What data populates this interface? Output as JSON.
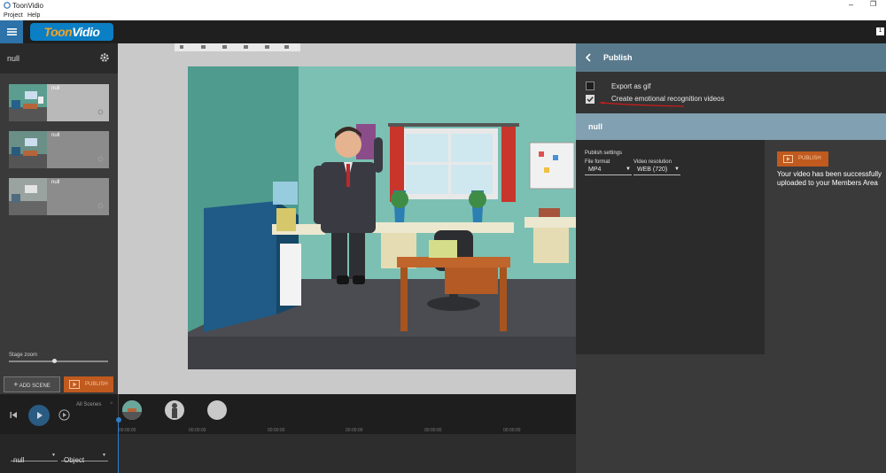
{
  "window": {
    "title": "ToonVidio",
    "controls": {
      "minimize": "–",
      "restore": "❐"
    }
  },
  "menu": {
    "items": [
      "Project",
      "Help"
    ]
  },
  "header": {
    "logo_part1": "Toon",
    "logo_part2": "Vidio",
    "notification_count": "1"
  },
  "sidebar": {
    "project_name": "null",
    "scenes": [
      {
        "name": "null"
      },
      {
        "name": "null"
      },
      {
        "name": "null"
      }
    ],
    "stage_zoom_label": "Stage zoom",
    "stage_zoom": 0.46,
    "add_scene_label": "ADD SCENE",
    "publish_label": "PUBLISH"
  },
  "publish_panel": {
    "title": "Publish",
    "export_gif_label": "Export as gif",
    "export_gif_checked": false,
    "emotion_label": "Create emotional recognition videos",
    "emotion_checked": true,
    "section_name": "null",
    "settings_label": "Publish settings",
    "file_format_label": "File format",
    "file_format_value": "MP4",
    "video_resolution_label": "Video resolution",
    "video_resolution_value": "WEB (720)",
    "publish_button_label": "PUBLISH",
    "success_message": "Your video has been successfully uploaded to your Members Area"
  },
  "timeline": {
    "all_scenes_label": "All Scenes",
    "time_marks": [
      "00:00:00",
      "00:00:00",
      "00:00:00",
      "00:00:00",
      "00:00:00",
      "00:00:00"
    ],
    "scene_select_value": "null",
    "object_select_value": "Object"
  },
  "colors": {
    "accent_orange": "#c05a1f",
    "panel_header": "#597a8c",
    "null_bar": "#81a0b1",
    "play_blue": "#2a5b82"
  }
}
